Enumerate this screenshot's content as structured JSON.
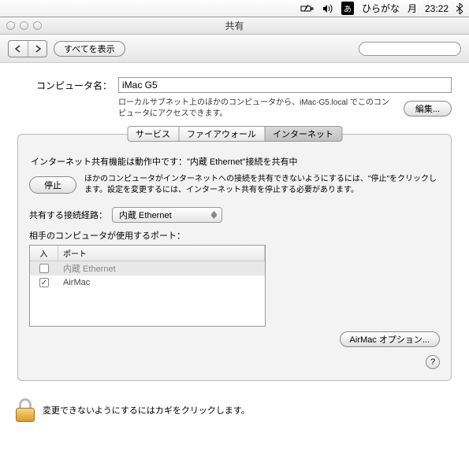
{
  "menubar": {
    "ime_badge": "あ",
    "ime_label": "ひらがな",
    "day": "月",
    "time": "23:22"
  },
  "window": {
    "title": "共有"
  },
  "toolbar": {
    "showall": "すべてを表示",
    "search_placeholder": ""
  },
  "computer": {
    "label": "コンピュータ名：",
    "value": "iMac G5",
    "desc": "ローカルサブネット上のほかのコンピュータから、iMac-G5.local でこのコンピュータにアクセスできます。",
    "edit": "編集..."
  },
  "tabs": {
    "services": "サービス",
    "firewall": "ファイアウォール",
    "internet": "インターネット"
  },
  "internet": {
    "status": "インターネット共有機能は動作中です：\"内蔵 Ethernet\"接続を共有中",
    "stop": "停止",
    "stop_desc": "ほかのコンピュータがインターネットへの接続を共有できないようにするには、\"停止\"をクリックします。設定を変更するには、インターネット共有を停止する必要があります。",
    "share_from_label": "共有する接続経路：",
    "share_from_value": "内蔵 Ethernet",
    "ports_label": "相手のコンピュータが使用するポート：",
    "port_header_on": "入",
    "port_header_name": "ポート",
    "ports": [
      {
        "checked": false,
        "name": "内蔵 Ethernet"
      },
      {
        "checked": true,
        "name": "AirMac"
      }
    ],
    "airmac_options": "AirMac オプション..."
  },
  "lock": {
    "text": "変更できないようにするにはカギをクリックします。"
  }
}
